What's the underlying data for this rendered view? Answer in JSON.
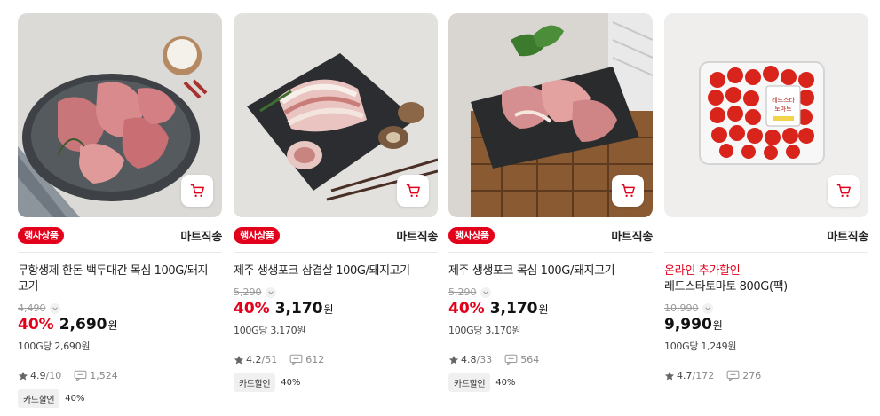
{
  "products": [
    {
      "badge": "행사상품",
      "shipping": "마트직송",
      "title_line1": "무항생제 한돈 백두대간 목심 100G/돼지",
      "title_line2": "고기",
      "original_price": "4,490",
      "discount_rate": "40%",
      "price": "2,690",
      "currency": "원",
      "unit_price": "100G당 2,690원",
      "rating": "4.9",
      "rating_count": "10",
      "review_count": "1,524",
      "card_label": "카드할인",
      "card_rate": "40%"
    },
    {
      "badge": "행사상품",
      "shipping": "마트직송",
      "title_line1": "제주 생생포크 삼겹살 100G/돼지고기",
      "original_price": "5,290",
      "discount_rate": "40%",
      "price": "3,170",
      "currency": "원",
      "unit_price": "100G당 3,170원",
      "rating": "4.2",
      "rating_count": "51",
      "review_count": "612",
      "card_label": "카드할인",
      "card_rate": "40%"
    },
    {
      "badge": "행사상품",
      "shipping": "마트직송",
      "title_line1": "제주 생생포크 목심 100G/돼지고기",
      "original_price": "5,290",
      "discount_rate": "40%",
      "price": "3,170",
      "currency": "원",
      "unit_price": "100G당 3,170원",
      "rating": "4.8",
      "rating_count": "33",
      "review_count": "564",
      "card_label": "카드할인",
      "card_rate": "40%"
    },
    {
      "shipping": "마트직송",
      "promo": "온라인 추가할인",
      "title_line1": "레드스타토마토 800G(팩)",
      "original_price": "10,990",
      "price": "9,990",
      "currency": "원",
      "unit_price": "100G당 1,249원",
      "rating": "4.7",
      "rating_count": "172",
      "review_count": "276",
      "package_label_1": "레드스타",
      "package_label_2": "토마토"
    }
  ],
  "colors": {
    "accent": "#e3001b",
    "muted": "#9a9a9a"
  },
  "icons": {
    "cart": "cart-icon",
    "star": "star-icon",
    "review": "review-icon",
    "chevron": "chevron-down-icon"
  }
}
